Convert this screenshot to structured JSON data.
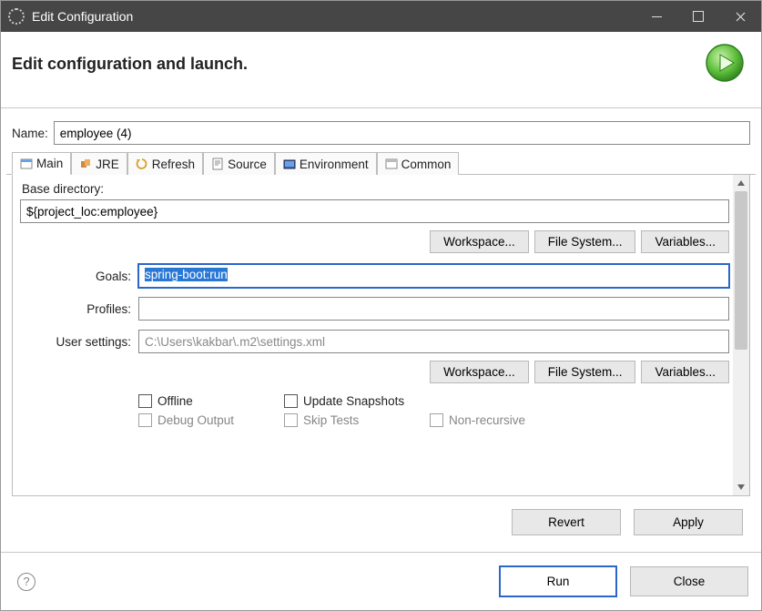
{
  "window": {
    "title": "Edit Configuration"
  },
  "header": {
    "title": "Edit configuration and launch."
  },
  "name": {
    "label": "Name:",
    "value": "employee (4)"
  },
  "tabs": [
    {
      "label": "Main",
      "icon": "main-tab-icon",
      "active": true
    },
    {
      "label": "JRE",
      "icon": "jre-tab-icon"
    },
    {
      "label": "Refresh",
      "icon": "refresh-tab-icon"
    },
    {
      "label": "Source",
      "icon": "source-tab-icon"
    },
    {
      "label": "Environment",
      "icon": "environment-tab-icon"
    },
    {
      "label": "Common",
      "icon": "common-tab-icon"
    }
  ],
  "main_tab": {
    "base_directory_label": "Base directory:",
    "base_directory_value": "${project_loc:employee}",
    "workspace_btn": "Workspace...",
    "filesystem_btn": "File System...",
    "variables_btn": "Variables...",
    "goals_label": "Goals:",
    "goals_value": "spring-boot:run",
    "profiles_label": "Profiles:",
    "profiles_value": "",
    "user_settings_label": "User settings:",
    "user_settings_value": "C:\\Users\\kakbar\\.m2\\settings.xml",
    "checkboxes": {
      "offline": "Offline",
      "update_snapshots": "Update Snapshots",
      "debug_output": "Debug Output",
      "skip_tests": "Skip Tests",
      "non_recursive": "Non-recursive"
    }
  },
  "buttons": {
    "revert": "Revert",
    "apply": "Apply",
    "run": "Run",
    "close": "Close"
  }
}
